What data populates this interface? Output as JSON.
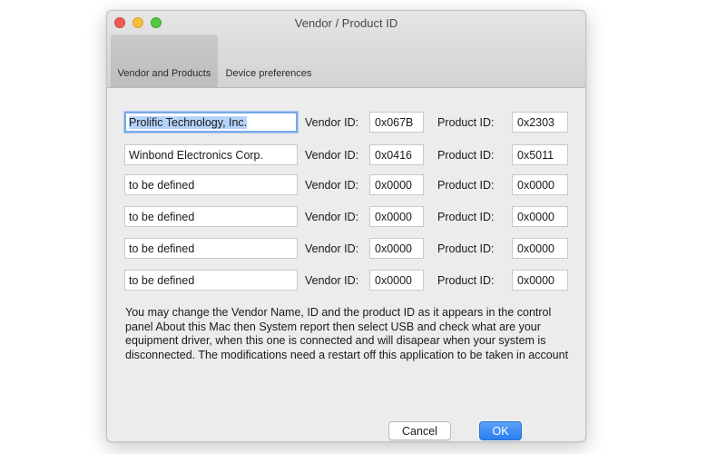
{
  "window": {
    "title": "Vendor / Product ID"
  },
  "tabs": [
    {
      "label": "Vendor and Products",
      "active": true
    },
    {
      "label": "Device preferences",
      "active": false
    }
  ],
  "labels": {
    "vendor_id": "Vendor ID:",
    "product_id": "Product  ID:"
  },
  "rows": [
    {
      "name": "Prolific Technology, Inc.",
      "vendor_id": "0x067B",
      "product_id": "0x2303"
    },
    {
      "name": "Winbond Electronics Corp.",
      "vendor_id": "0x0416",
      "product_id": "0x5011"
    },
    {
      "name": "to be defined",
      "vendor_id": "0x0000",
      "product_id": "0x0000"
    },
    {
      "name": "to be defined",
      "vendor_id": "0x0000",
      "product_id": "0x0000"
    },
    {
      "name": "to be defined",
      "vendor_id": "0x0000",
      "product_id": "0x0000"
    },
    {
      "name": "to be defined",
      "vendor_id": "0x0000",
      "product_id": "0x0000"
    }
  ],
  "info_text": "You may change the Vendor Name, ID and the product ID as it appears in the control panel About this Mac then System report then select USB and check what are your equipment driver, when this one is connected and will disapear when your system is disconnected. The modifications need a restart off this application to be taken in account",
  "buttons": {
    "cancel": "Cancel",
    "ok": "OK"
  },
  "colors": {
    "ok_button": "#2c7ef0",
    "close_button": "#ee5b55",
    "minimize_button": "#f5bd3f",
    "zoom_button": "#55c740",
    "focus_ring": "#7aa9e6"
  }
}
